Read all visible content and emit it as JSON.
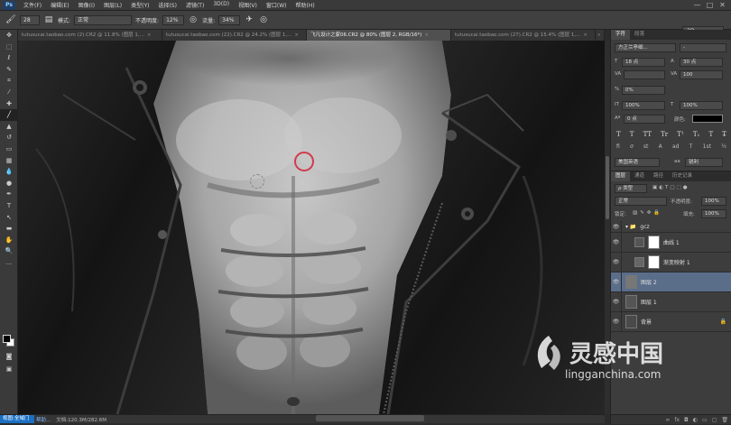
{
  "app": {
    "logo": "Ps"
  },
  "menu": [
    "文件(F)",
    "编辑(E)",
    "图像(I)",
    "图层(L)",
    "类型(Y)",
    "选择(S)",
    "滤镜(T)",
    "3D(D)",
    "视图(V)",
    "窗口(W)",
    "帮助(H)"
  ],
  "window_controls": [
    "—",
    "□",
    "✕"
  ],
  "options": {
    "mode_label": "模式:",
    "mode_value": "正常",
    "opacity_label": "不透明度:",
    "opacity_value": "12%",
    "flow_label": "流量:",
    "flow_value": "34%",
    "workspace": "3D",
    "brush_size": "28"
  },
  "tabs": [
    {
      "label": "tutusucai.taobao.com (2).CR2 @ 11.8% (图层 1,..."
    },
    {
      "label": "tutusucai.taobao.com (22).CR2 @ 24.2% (图层 1,..."
    },
    {
      "label": "飞凡设计之家06.CR2 @ 80% (图层 2, RGB/16*)",
      "active": true
    },
    {
      "label": "tutusucai.taobao.com (27).CR2 @ 15.4% (图层 1,..."
    }
  ],
  "tab_close": "×",
  "tab_more": "»",
  "status": {
    "zoom": "视图:全域门",
    "zoom_link": "帮助...",
    "doc": "文档:120.3M/282.6M"
  },
  "panels": {
    "char_tabs": [
      "字符",
      "段落"
    ],
    "font_family": "方正兰亭细...",
    "font_style": "-",
    "font_size": "18 点",
    "leading": "30 点",
    "kerning": "",
    "tracking": "100",
    "scale_label": "0%",
    "vscale": "100%",
    "hscale": "100%",
    "baseline": "0 点",
    "color_label": "颜色:",
    "type_format": [
      "T",
      "T",
      "TT",
      "Tr",
      "T¹",
      "T₁",
      "T",
      "T̶"
    ],
    "type_format2": [
      "fi",
      "ơ",
      "st",
      "A",
      "ad",
      "T",
      "1st",
      "½"
    ],
    "language": "美国英语",
    "aa_label": "aa",
    "aa_value": "锐利",
    "layer_tabs": [
      "图层",
      "通道",
      "路径",
      "历史记录"
    ],
    "filter_label": "ρ 类型",
    "blend_mode": "正常",
    "opacity_label": "不透明度:",
    "opacity_value": "100%",
    "lock_label": "锁定:",
    "fill_label": "填充:",
    "fill_value": "100%",
    "layers": [
      {
        "name": "gcz",
        "type": "group"
      },
      {
        "name": "曲线 1",
        "type": "adjust"
      },
      {
        "name": "渐变映射 1",
        "type": "adjust"
      },
      {
        "name": "图层 2",
        "type": "gray",
        "selected": true
      },
      {
        "name": "图层 1",
        "type": "image"
      },
      {
        "name": "背景",
        "type": "image",
        "locked": true
      }
    ],
    "footer_icons": [
      "link-icon",
      "fx-icon",
      "mask-icon",
      "adjust-icon",
      "folder-icon",
      "new-layer-icon",
      "trash-icon"
    ]
  },
  "watermark": {
    "cn": "灵感中国",
    "en": "lingganchina.com"
  },
  "colors": {
    "accent": "#1b6fc4",
    "selection": "#5a6e8a",
    "brush_cursor": "#d33a4c"
  }
}
